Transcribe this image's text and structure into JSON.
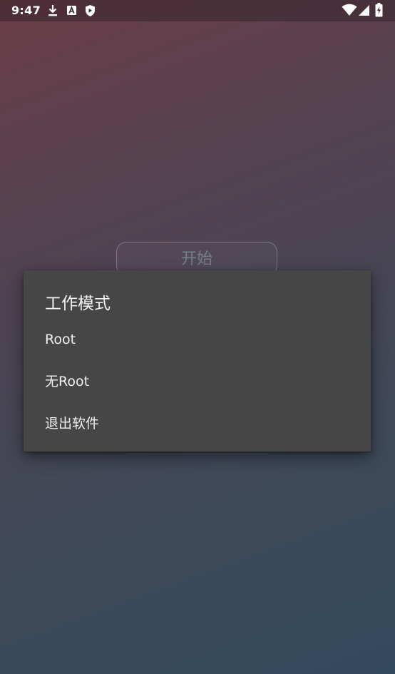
{
  "status_bar": {
    "time": "9:47",
    "left_icons": [
      "download-icon",
      "a-badge-icon",
      "shield-icon"
    ],
    "right_icons": [
      "wifi-icon",
      "signal-icon",
      "battery-charging-icon"
    ]
  },
  "main": {
    "start_button_label": "开始"
  },
  "dialog": {
    "title": "工作模式",
    "options": [
      {
        "label": "Root"
      },
      {
        "label": "无Root"
      },
      {
        "label": "退出软件"
      }
    ]
  },
  "colors": {
    "dialog_bg": "#464646",
    "dialog_text": "#f0f0f0",
    "gradient_top": "#6a3d48",
    "gradient_bottom": "#334a5c"
  }
}
